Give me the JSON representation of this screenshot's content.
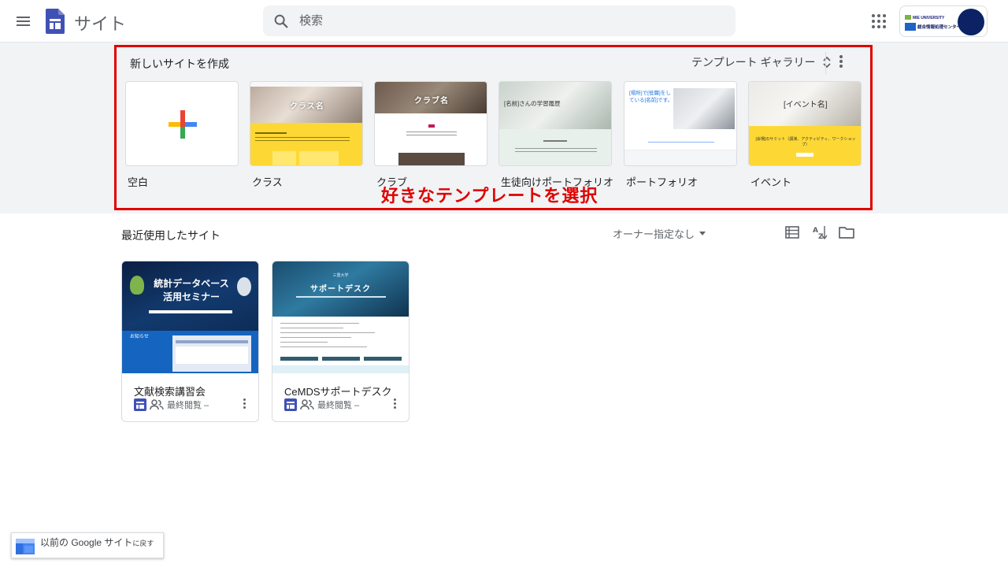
{
  "header": {
    "app_title": "サイト",
    "search_placeholder": "検索",
    "org_logo_text": "MIE UNIVERSITY",
    "org_name": "総合情報処理センター"
  },
  "gallery": {
    "title": "新しいサイトを作成",
    "toggle_label": "テンプレート ギャラリー",
    "templates": [
      {
        "label": "空白"
      },
      {
        "label": "クラス",
        "thumb_title": "クラス名"
      },
      {
        "label": "クラブ",
        "thumb_title": "クラブ名"
      },
      {
        "label": "生徒向けポートフォリオ",
        "thumb_title": "[名前]さんの学習履歴"
      },
      {
        "label": "ポートフォリオ",
        "thumb_title": "[場所]で[役職]をしている[名前]です。"
      },
      {
        "label": "イベント",
        "thumb_title": "[イベント名]",
        "thumb_subtitle": "[会場]のサミット（講演、アクティビティ、ワークショップ）"
      }
    ],
    "annotation": "好きなテンプレートを選択"
  },
  "recent": {
    "title": "最近使用したサイト",
    "owner_filter": "オーナー指定なし",
    "sites": [
      {
        "name": "文献検索講習会",
        "meta": "最終閲覧 –",
        "thumb_title": "統計データベース活用セミナー",
        "thumb_sub": "お知らせ"
      },
      {
        "name": "CeMDSサポートデスク",
        "meta": "最終閲覧 –",
        "thumb_title": "サポートデスク",
        "thumb_sub": "三重大学"
      }
    ]
  },
  "classic": {
    "label_main": "以前の Google サイト",
    "label_suffix": "に戻す"
  },
  "colors": {
    "accent_red": "#e00000",
    "sites_blue": "#4051b5",
    "google_blue": "#4285f4",
    "google_red": "#ea4335",
    "google_yellow": "#fbbc04",
    "google_green": "#34a853"
  }
}
